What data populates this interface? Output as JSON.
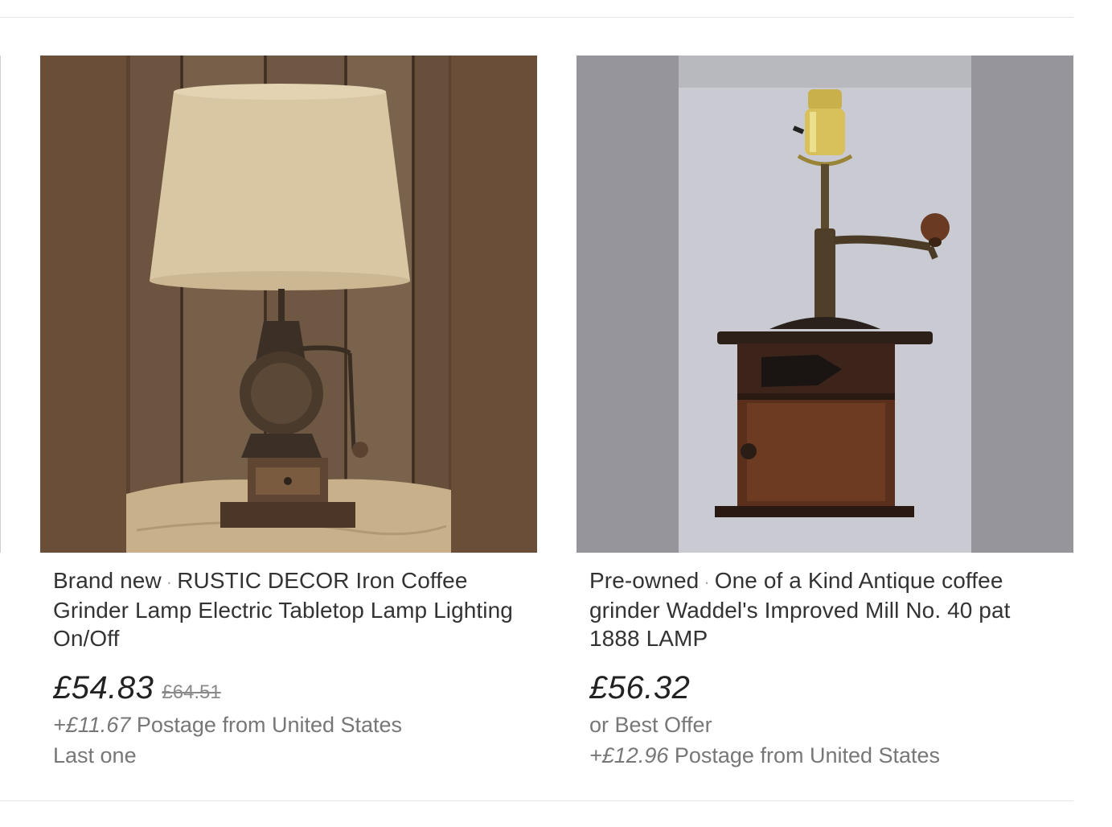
{
  "listings": [
    {
      "condition": "Brand new",
      "separator": "·",
      "title": "RUSTIC DECOR Iron Coffee Grinder Lamp Electric Tabletop Lamp Lighting On/Off",
      "price": "£54.83",
      "original_price": "£64.51",
      "postage_amount": "+£11.67",
      "postage_text": "Postage from United States",
      "stock_note": "Last one",
      "image_icon": "table-lamp-photo",
      "image_bg": "#6b4e37"
    },
    {
      "condition": "Pre-owned",
      "separator": "·",
      "title": "One of a Kind Antique coffee grinder Waddel's Improved Mill No. 40 pat 1888 LAMP",
      "price": "£56.32",
      "offer_text": "or Best Offer",
      "postage_amount": "+£12.96",
      "postage_text": "Postage from United States",
      "image_icon": "grinder-lamp-photo",
      "image_bg": "#96959b"
    }
  ]
}
